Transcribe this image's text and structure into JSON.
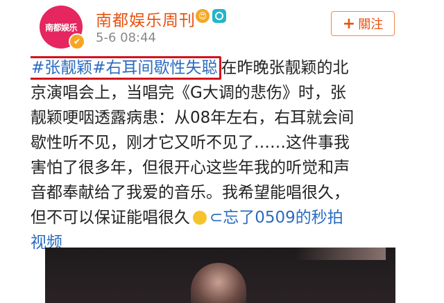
{
  "account": {
    "avatar_text": "南都娱乐",
    "name": "南都娱乐周刊",
    "time": "5-6 08:44",
    "verified_icon": "✔",
    "vip_icon": "😍"
  },
  "follow": {
    "plus": "+",
    "label": "關注"
  },
  "post": {
    "line1_topic": "#张靓颖#右耳间歇性失聪",
    "line1_rest": "在昨晚张靓颖的北",
    "line2": "京演唱会上，当唱完《G大调的悲伤》时，张",
    "line3": "靓颖哽咽透露病患：从08年左右，右耳就会间",
    "line4": "歇性听不见，刚才它又听不见了……这件事我",
    "line5": "害怕了很多年，但很开心这些年我的听觉和声",
    "line6": "音都奉献给了我爱的音乐。我希望能唱很久，",
    "line7_text": "但不可以保证能唱很久",
    "line7_link": "⊂忘了0509的秒拍",
    "line8_link": "视频"
  },
  "colors": {
    "accent": "#e8520f",
    "link": "#2a6bbf",
    "highlight_box": "#d4121c",
    "avatar_bg": "#e5265f"
  }
}
